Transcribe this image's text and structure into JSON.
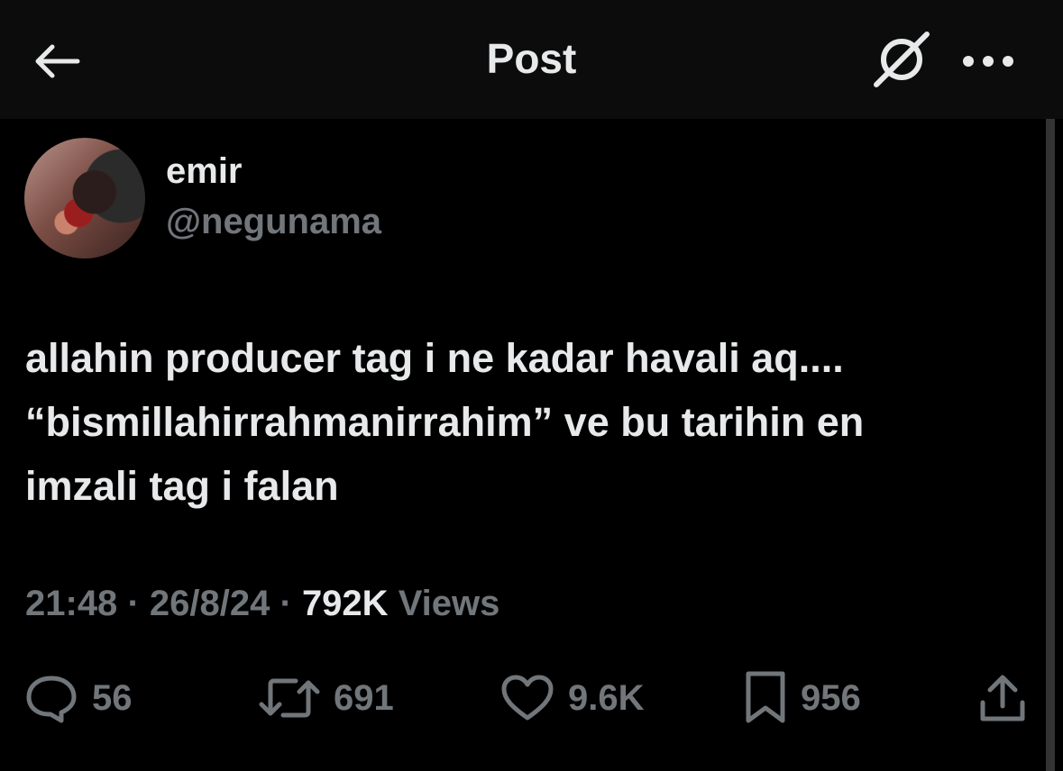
{
  "header": {
    "title": "Post"
  },
  "author": {
    "display_name": "emir",
    "handle": "@negunama"
  },
  "tweet": {
    "lines": [
      "allahin producer tag i ne kadar havali aq....",
      "“bismillahirrahmanirrahim” ve bu tarihin en",
      "imzali tag i falan"
    ]
  },
  "meta": {
    "time": "21:48",
    "sep": "·",
    "date": "26/8/24",
    "views_count": "792K",
    "views_label": "Views"
  },
  "actions": {
    "replies": "56",
    "reposts": "691",
    "likes": "9.6K",
    "bookmarks": "956"
  },
  "icons": [
    "back-arrow-icon",
    "grok-icon",
    "more-icon",
    "reply-icon",
    "repost-icon",
    "like-icon",
    "bookmark-icon",
    "share-icon"
  ],
  "colors": {
    "background": "#000000",
    "header_bg": "#0c0c0c",
    "text": "#e7e9ea",
    "muted": "#71767b"
  }
}
